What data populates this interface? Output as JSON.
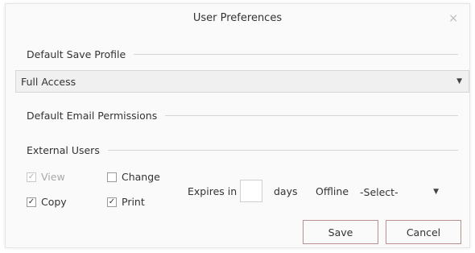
{
  "dialog": {
    "title": "User Preferences",
    "close_glyph": "×"
  },
  "save_profile": {
    "label": "Default Save Profile",
    "selected": "Full Access",
    "caret_icon": "chevron-down-icon"
  },
  "email_permissions": {
    "label": "Default Email Permissions"
  },
  "external_users": {
    "label": "External Users",
    "view": {
      "label": "View",
      "checked": true,
      "disabled": true
    },
    "change": {
      "label": "Change",
      "checked": false
    },
    "copy": {
      "label": "Copy",
      "checked": true
    },
    "print": {
      "label": "Print",
      "checked": true
    },
    "expires_label": "Expires in",
    "expires_value": "",
    "days_label": "days",
    "offline_label": "Offline",
    "offline_selected": "-Select-"
  },
  "buttons": {
    "save_label": "Save",
    "cancel_label": "Cancel"
  },
  "colors": {
    "button_border": "#b89090",
    "select_bg": "#f0f0f0"
  }
}
